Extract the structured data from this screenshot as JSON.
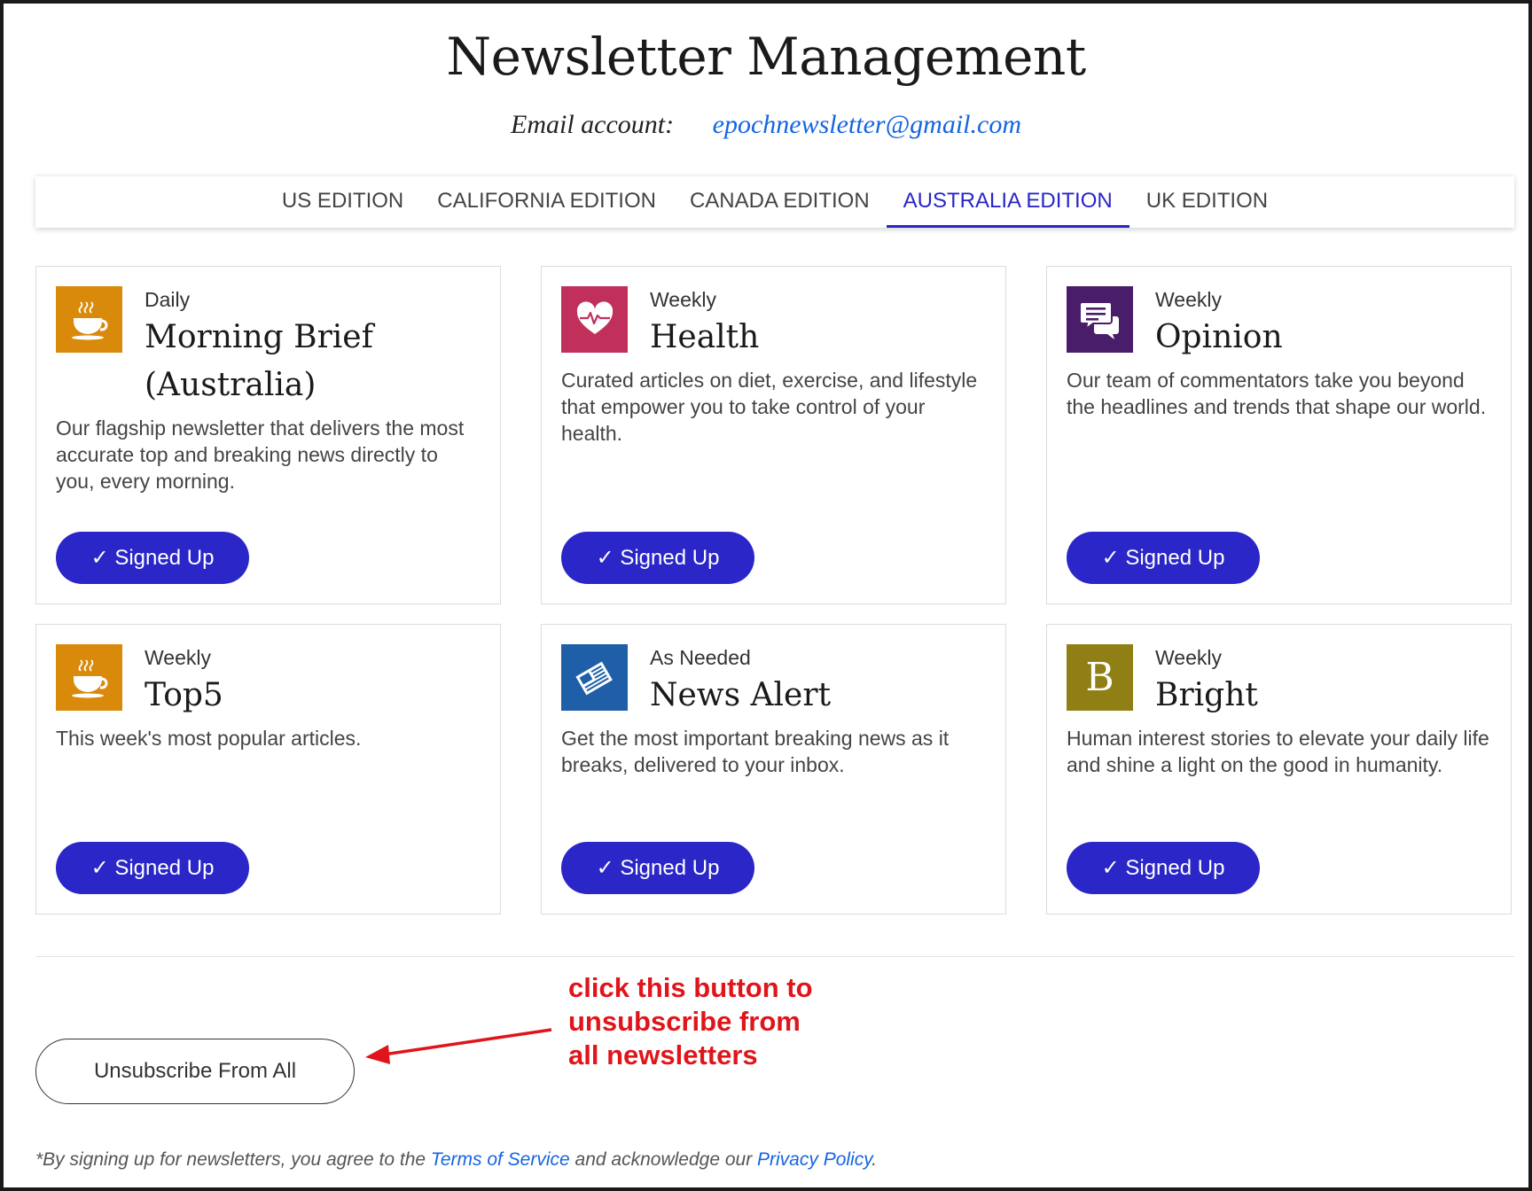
{
  "header": {
    "title": "Newsletter Management",
    "account_label": "Email account:",
    "account_email": "epochnewsletter@gmail.com"
  },
  "tabs": [
    {
      "label": "US EDITION",
      "active": false
    },
    {
      "label": "CALIFORNIA EDITION",
      "active": false
    },
    {
      "label": "CANADA EDITION",
      "active": false
    },
    {
      "label": "AUSTRALIA EDITION",
      "active": true
    },
    {
      "label": "UK EDITION",
      "active": false
    }
  ],
  "newsletters": [
    {
      "frequency": "Daily",
      "title_line1": "Morning Brief",
      "title_line2": "(Australia)",
      "description": "Our flagship newsletter that delivers the most accurate top and breaking news directly to you, every morning.",
      "icon": "coffee-cup-icon",
      "icon_color": "#d98a0b",
      "button": "✓ Signed Up"
    },
    {
      "frequency": "Weekly",
      "title_line1": "Health",
      "title_line2": "",
      "description": "Curated articles on diet, exercise, and lifestyle that empower you to take control of your health.",
      "icon": "heart-pulse-icon",
      "icon_color": "#c0305b",
      "button": "✓ Signed Up"
    },
    {
      "frequency": "Weekly",
      "title_line1": "Opinion",
      "title_line2": "",
      "description": "Our team of commentators take you beyond the headlines and trends that shape our world.",
      "icon": "chat-bubbles-icon",
      "icon_color": "#4a1d6b",
      "button": "✓ Signed Up"
    },
    {
      "frequency": "Weekly",
      "title_line1": "Top5",
      "title_line2": "",
      "description": "This week's most popular articles.",
      "icon": "coffee-cup-icon",
      "icon_color": "#d98a0b",
      "button": "✓ Signed Up"
    },
    {
      "frequency": "As Needed",
      "title_line1": "News Alert",
      "title_line2": "",
      "description": "Get the most important breaking news as it breaks, delivered to your inbox.",
      "icon": "newspaper-icon",
      "icon_color": "#1f5fa8",
      "button": "✓ Signed Up"
    },
    {
      "frequency": "Weekly",
      "title_line1": "Bright",
      "title_line2": "",
      "description": "Human interest stories to elevate your daily life and shine a light on the good in humanity.",
      "icon": "letter-b-icon",
      "icon_letter": "B",
      "icon_color": "#8f7f14",
      "button": "✓ Signed Up"
    }
  ],
  "unsubscribe_label": "Unsubscribe From All",
  "annotation": {
    "line1": "click this button to",
    "line2": "unsubscribe from",
    "line3": "all newsletters",
    "color": "#e0151b"
  },
  "footer": {
    "prefix": "*By signing up for newsletters, you agree to the ",
    "terms": "Terms of Service",
    "middle": " and acknowledge our ",
    "privacy": "Privacy Policy",
    "suffix": "."
  },
  "colors": {
    "accent": "#2a26c7",
    "link": "#1565e0"
  }
}
